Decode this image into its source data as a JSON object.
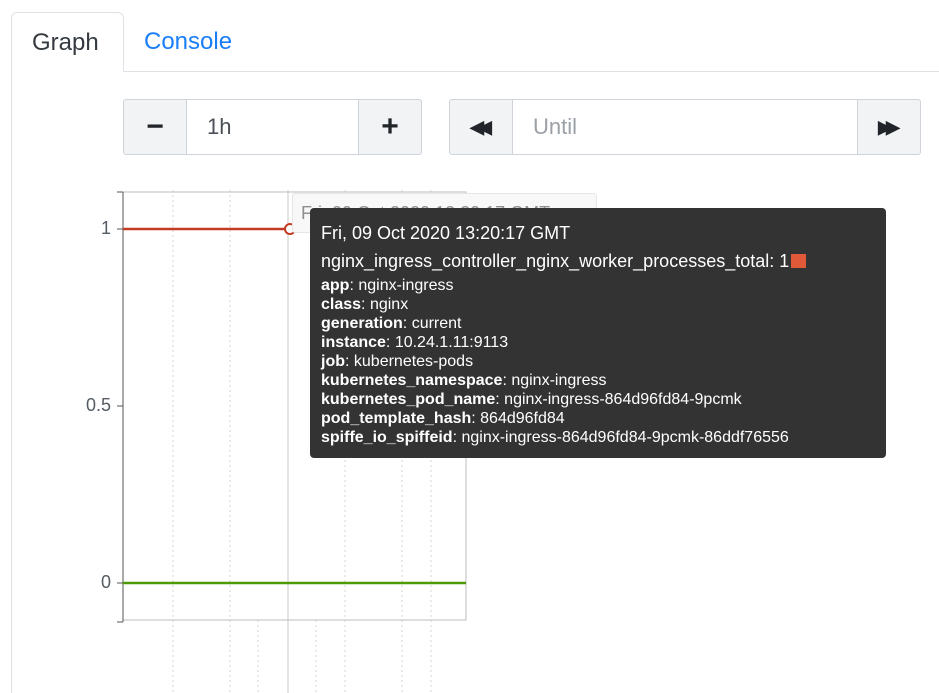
{
  "tabs": {
    "graph": "Graph",
    "console": "Console"
  },
  "range": {
    "decrement": "−",
    "value": "1h",
    "increment": "+"
  },
  "until": {
    "back": "◀◀",
    "placeholder": "Until",
    "forward": "▶▶"
  },
  "chart_data": {
    "type": "line",
    "yticks": [
      "1",
      "0.5",
      "0"
    ],
    "ylim": [
      -0.1,
      1.1
    ],
    "grid": true,
    "series": [
      {
        "name": "nginx_ingress_controller_nginx_worker_processes_total",
        "color": "#c23b22",
        "values": [
          1,
          1
        ]
      },
      {
        "color": "#4e9a06",
        "values": [
          0,
          0
        ]
      }
    ]
  },
  "ghost_label": "Fri, 09 Oct 2020 13:20:17 GMT",
  "tooltip": {
    "time": "Fri, 09 Oct 2020 13:20:17 GMT",
    "metric": "nginx_ingress_controller_nginx_worker_processes_total: 1",
    "swatch_color": "#e05a3a",
    "labels": [
      {
        "key": "app",
        "value": ": nginx-ingress"
      },
      {
        "key": "class",
        "value": ": nginx"
      },
      {
        "key": "generation",
        "value": ": current"
      },
      {
        "key": "instance",
        "value": ": 10.24.1.11:9113"
      },
      {
        "key": "job",
        "value": ": kubernetes-pods"
      },
      {
        "key": "kubernetes_namespace",
        "value": ": nginx-ingress"
      },
      {
        "key": "kubernetes_pod_name",
        "value": ": nginx-ingress-864d96fd84-9pcmk"
      },
      {
        "key": "pod_template_hash",
        "value": ": 864d96fd84"
      },
      {
        "key": "spiffe_io_spiffeid",
        "value": ": nginx-ingress-864d96fd84-9pcmk-86ddf76556"
      }
    ]
  }
}
